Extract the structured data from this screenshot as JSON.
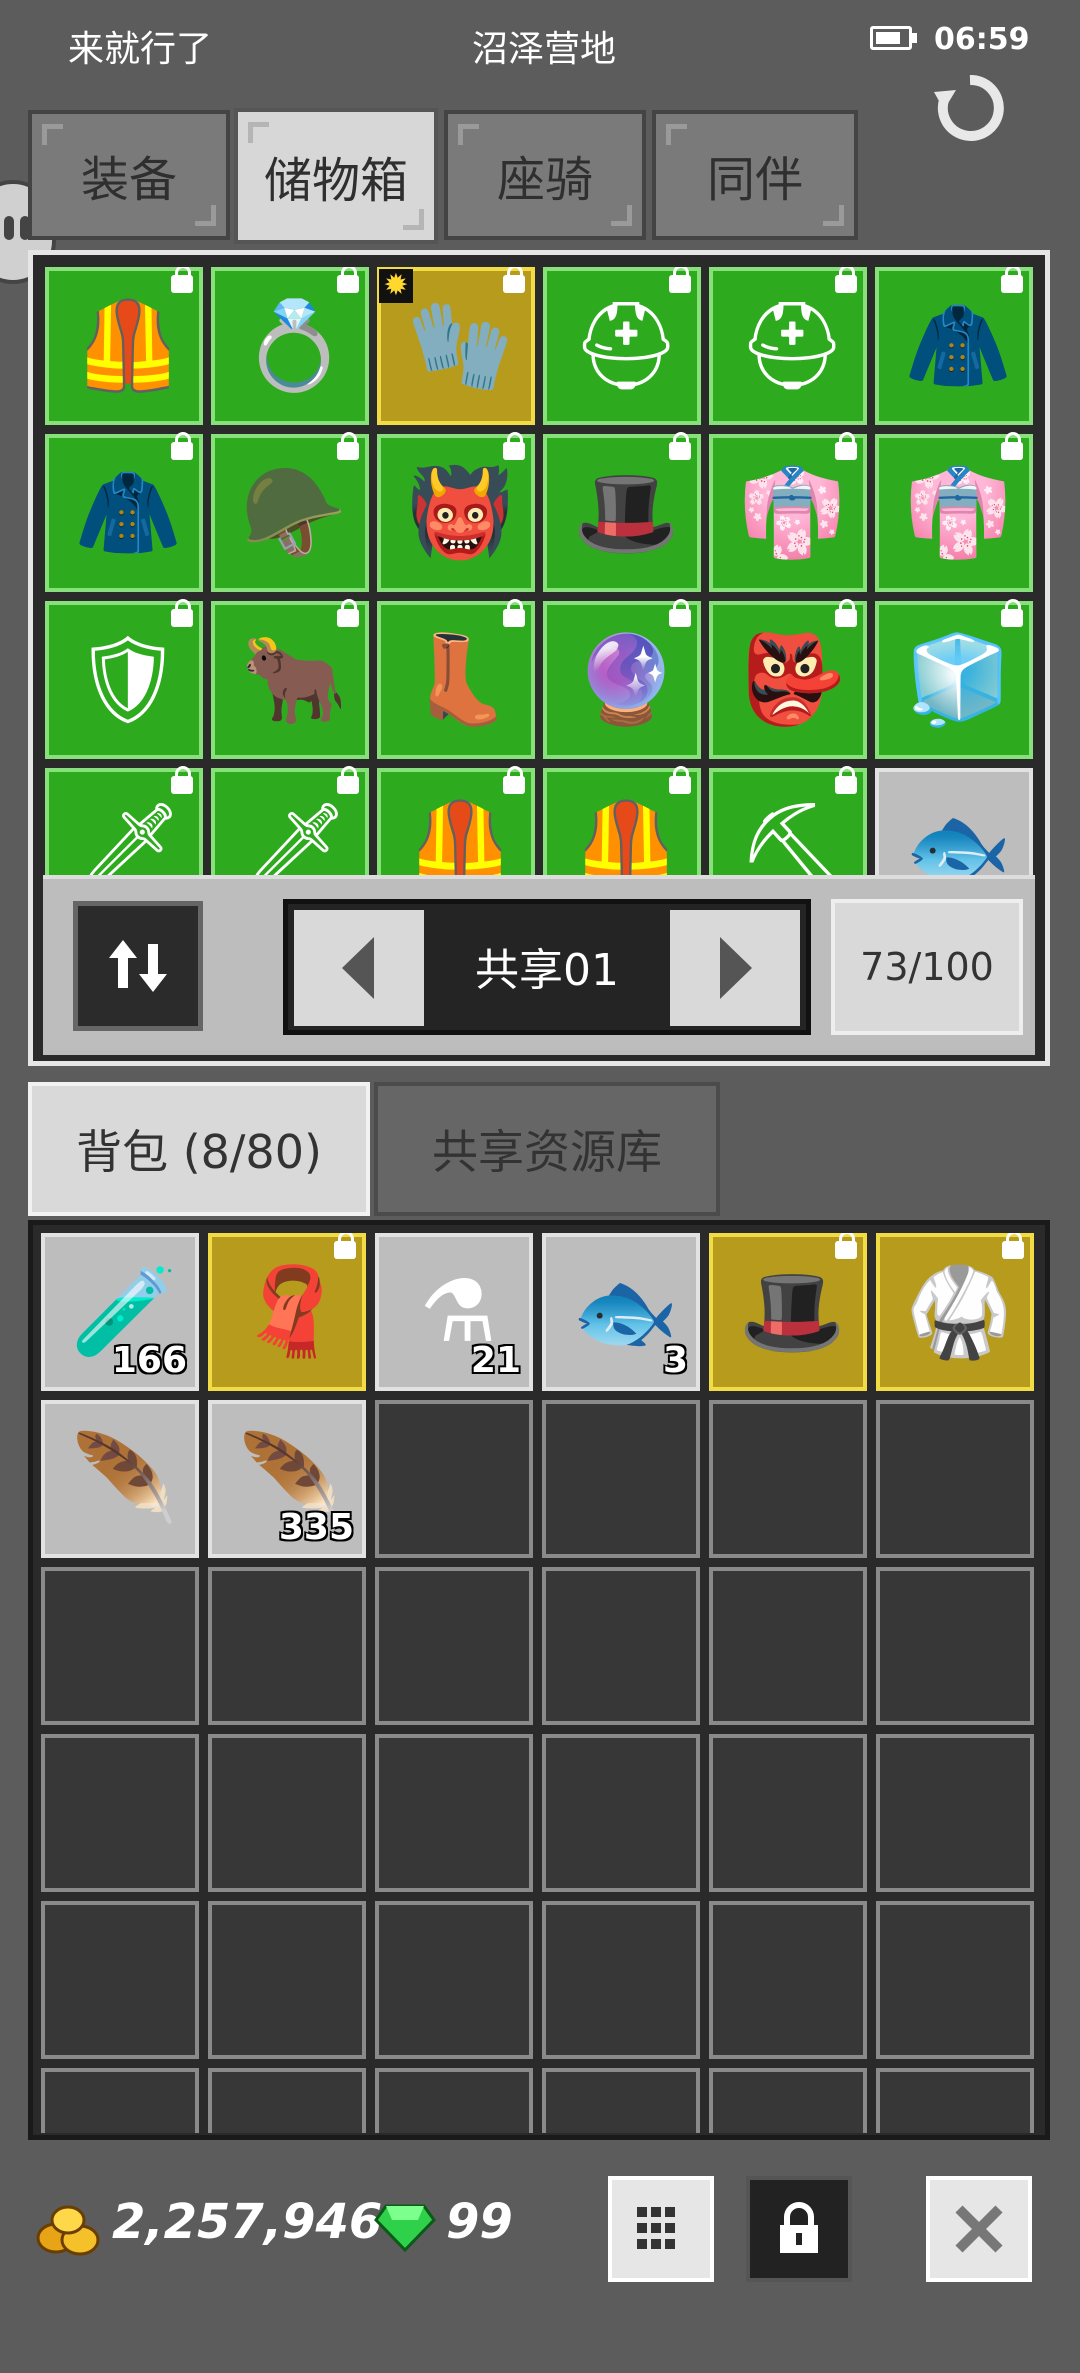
{
  "status": {
    "left_text": "来就行了",
    "center_text": "沼泽营地",
    "time": "06:59"
  },
  "tabs": [
    "装备",
    "储物箱",
    "座骑",
    "同伴"
  ],
  "active_tab": "储物箱",
  "storage": {
    "rows": [
      [
        {
          "style": "green",
          "icon": "leather-armor-icon",
          "glyph": "🦺",
          "locked": true
        },
        {
          "style": "green",
          "icon": "purple-ring-icon",
          "glyph": "💍",
          "locked": true
        },
        {
          "style": "gold",
          "icon": "gauntlet-icon",
          "glyph": "🧤",
          "locked": true,
          "star": true
        },
        {
          "style": "green",
          "icon": "iron-helmet-icon",
          "glyph": "⛑",
          "locked": true
        },
        {
          "style": "green",
          "icon": "iron-helmet-icon",
          "glyph": "⛑",
          "locked": true
        },
        {
          "style": "green",
          "icon": "red-cape-icon",
          "glyph": "🧥",
          "locked": true
        }
      ],
      [
        {
          "style": "green",
          "icon": "red-cape-icon",
          "glyph": "🧥",
          "locked": true
        },
        {
          "style": "green",
          "icon": "bronze-helmet-icon",
          "glyph": "🪖",
          "locked": true
        },
        {
          "style": "green",
          "icon": "horned-red-helmet-icon",
          "glyph": "👹",
          "locked": true
        },
        {
          "style": "green",
          "icon": "red-hat-icon",
          "glyph": "🎩",
          "locked": true
        },
        {
          "style": "green",
          "icon": "red-robe-icon",
          "glyph": "👘",
          "locked": true
        },
        {
          "style": "green",
          "icon": "red-robe-icon",
          "glyph": "👘",
          "locked": true
        }
      ],
      [
        {
          "style": "green",
          "icon": "red-chest-armor-icon",
          "glyph": "🛡",
          "locked": true
        },
        {
          "style": "green",
          "icon": "horned-silver-helmet-icon",
          "glyph": "🐂",
          "locked": true
        },
        {
          "style": "green",
          "icon": "teal-boots-icon",
          "glyph": "👢",
          "locked": true
        },
        {
          "style": "green",
          "icon": "teal-orb-icon",
          "glyph": "🔮",
          "locked": true
        },
        {
          "style": "green",
          "icon": "beast-mask-icon",
          "glyph": "👺",
          "locked": true
        },
        {
          "style": "green",
          "icon": "ice-gauntlet-icon",
          "glyph": "🧊",
          "locked": true
        }
      ],
      [
        {
          "style": "green",
          "icon": "red-sword-icon",
          "glyph": "🗡",
          "locked": true
        },
        {
          "style": "green",
          "icon": "red-sword-icon",
          "glyph": "🗡",
          "locked": true
        },
        {
          "style": "green",
          "icon": "leather-armor-icon",
          "glyph": "🦺",
          "locked": true
        },
        {
          "style": "green",
          "icon": "leather-armor-icon",
          "glyph": "🦺",
          "locked": true
        },
        {
          "style": "green",
          "icon": "pickaxe-icon",
          "glyph": "⛏",
          "locked": true
        },
        {
          "style": "grey",
          "icon": "fish-icon",
          "glyph": "🐟",
          "locked": false
        }
      ]
    ]
  },
  "pager": {
    "label": "共享01"
  },
  "capacity": "73/100",
  "panel_tabs": {
    "backpack": "背包 (8/80)",
    "shared": "共享资源库"
  },
  "backpack": {
    "items": [
      {
        "style": "grey",
        "icon": "blue-potion-icon",
        "glyph": "🧪",
        "count": "166"
      },
      {
        "style": "gold",
        "icon": "red-cloak-icon",
        "glyph": "🧣",
        "locked": true
      },
      {
        "style": "grey",
        "icon": "red-potion-icon",
        "glyph": "⚗",
        "count": "21"
      },
      {
        "style": "grey",
        "icon": "fish-icon",
        "glyph": "🐟",
        "count": "3"
      },
      {
        "style": "gold",
        "icon": "dark-hat-icon",
        "glyph": "🎩",
        "locked": true
      },
      {
        "style": "gold",
        "icon": "dark-armor-icon",
        "glyph": "🥋",
        "locked": true
      },
      {
        "style": "grey",
        "icon": "pink-feather-icon",
        "glyph": "🪶"
      },
      {
        "style": "grey",
        "icon": "blue-feather-icon",
        "glyph": "🪶",
        "count": "335"
      }
    ],
    "total_slots": 36
  },
  "footer": {
    "gold": "2,257,946",
    "gems": "99"
  },
  "colors": {
    "background": "#5c5c5c",
    "green_slot": "#2eaa1f",
    "gold_slot": "#b79b1c",
    "grey_slot": "#bdbdbd"
  }
}
